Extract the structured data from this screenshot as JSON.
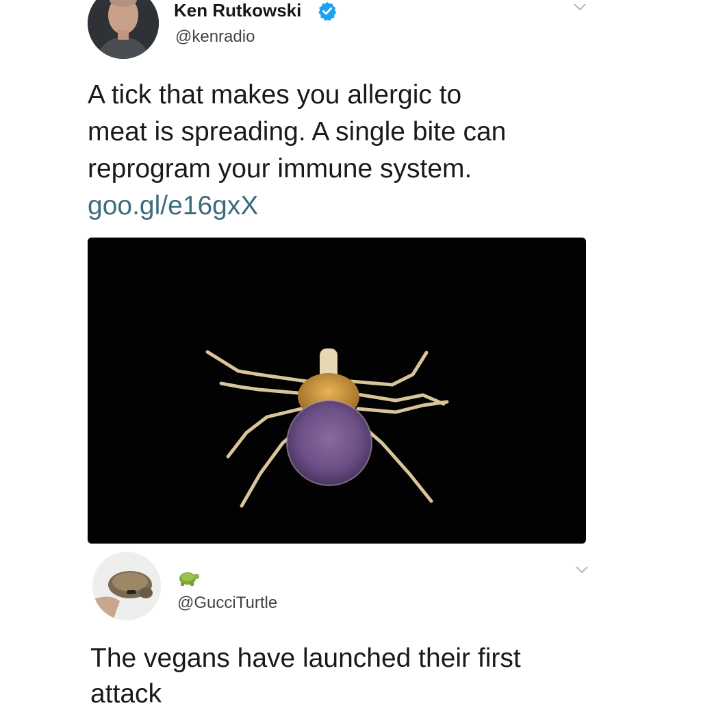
{
  "tweet": {
    "author_name": "Ken Rutkowski",
    "author_handle": "@kenradio",
    "text_lines": [
      "A tick that makes you allergic to",
      "meat is spreading. A single bite can",
      "reprogram your immune system."
    ],
    "link": "goo.gl/e16gxX",
    "media_icon": "tick-photo",
    "verified_icon": "verified-badge-icon"
  },
  "reply": {
    "display_name_icon": "turtle-emoji-icon",
    "author_handle": "@GucciTurtle",
    "text_lines": [
      "The vegans have launched their first",
      "attack"
    ]
  },
  "colors": {
    "link": "#3b6b7e",
    "verified": "#1da1f2",
    "media_bg": "#020202"
  }
}
